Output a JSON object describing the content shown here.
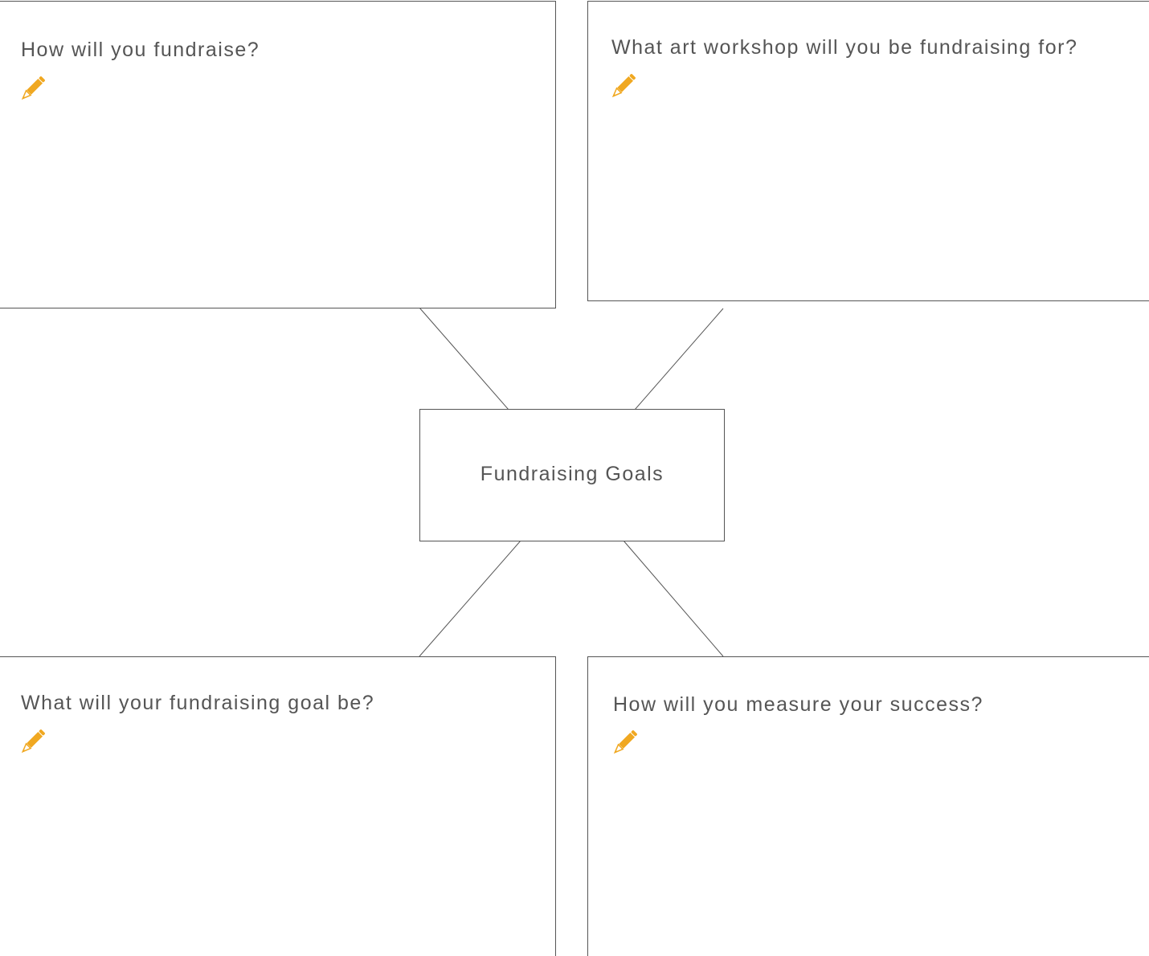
{
  "diagram": {
    "center": {
      "label": "Fundraising Goals"
    },
    "questions": [
      {
        "id": "top-left",
        "text": "How will you fundraise?",
        "icon": "pencil-icon"
      },
      {
        "id": "top-right",
        "text": "What art workshop will you be fundraising for?",
        "icon": "pencil-icon"
      },
      {
        "id": "bottom-left",
        "text": "What will your fundraising goal be?",
        "icon": "pencil-icon"
      },
      {
        "id": "bottom-right",
        "text": "How will you measure your success?",
        "icon": "pencil-icon"
      }
    ],
    "colors": {
      "border": "#555555",
      "text": "#555555",
      "pencil": "#f0a821"
    }
  }
}
